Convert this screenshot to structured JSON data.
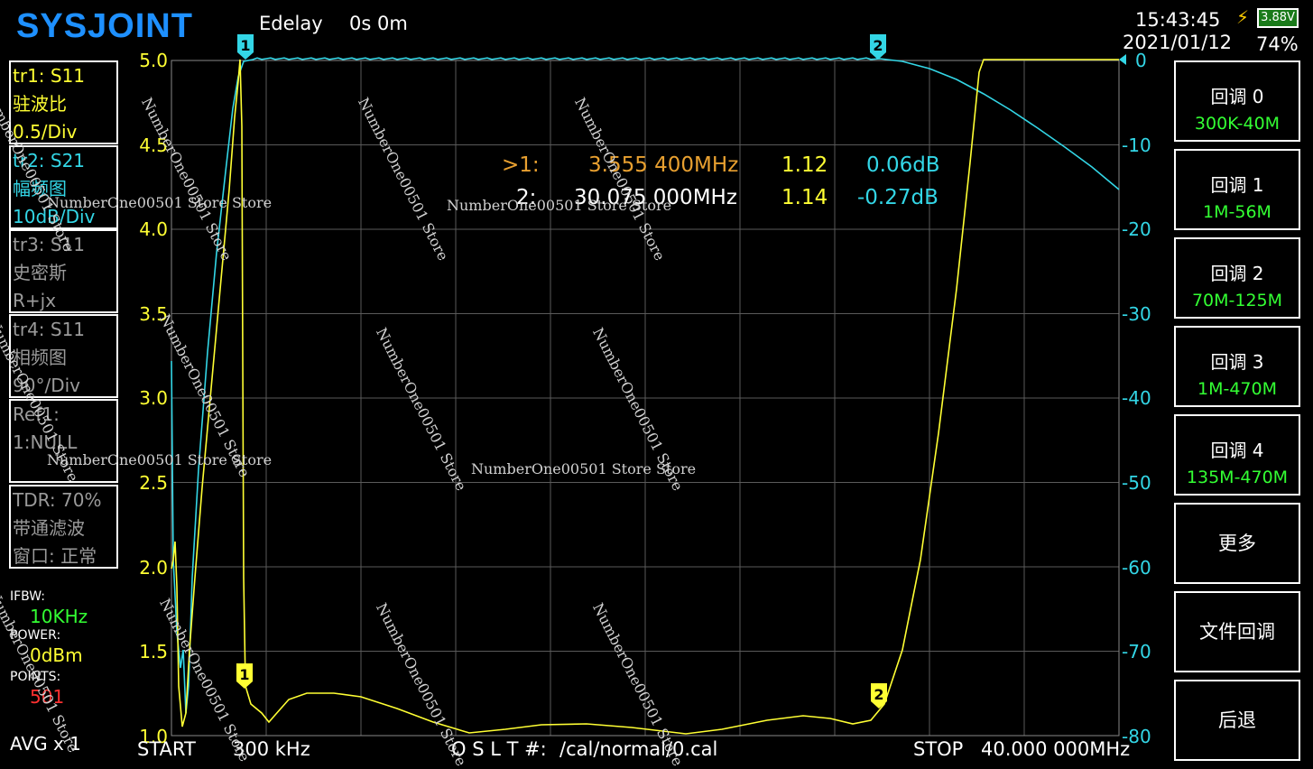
{
  "brand": "SYSJOINT",
  "header": {
    "edelay_label": "Edelay",
    "edelay_value": "0s 0m",
    "time": "15:43:45",
    "date": "2021/01/12",
    "battery_pct": "74%",
    "battery_voltage": "3.88V"
  },
  "traces": [
    {
      "line1": "tr1:   S11",
      "line2": "驻波比",
      "line3": "0.5/Div",
      "color": "#ffff33"
    },
    {
      "line1": "tr2:   S21",
      "line2": "幅频图",
      "line3": "10dB/Div",
      "color": "#33d6e6"
    },
    {
      "line1": "tr3:   S11",
      "line2": "史密斯",
      "line3": "R+jx",
      "color": "#9a9a9a"
    },
    {
      "line1": "tr4:   S11",
      "line2": "相频图",
      "line3": "90°/Div",
      "color": "#9a9a9a"
    },
    {
      "line1": "Ref1:",
      "line2": "1:NULL",
      "line3": "",
      "color": "#9a9a9a"
    },
    {
      "line1": "TDR: 70%",
      "line2": "带通滤波",
      "line3": "窗口: 正常",
      "color": "#9a9a9a"
    }
  ],
  "settings": {
    "ifbw_label": "IFBW:",
    "ifbw_value": "10KHz",
    "power_label": "POWER:",
    "power_value": "0dBm",
    "points_label": "POINTS:",
    "points_value": "501",
    "avg": "AVG x 1"
  },
  "markers": {
    "m1": {
      "prefix": ">1:",
      "freq": "3.555 400MHz",
      "swr": "1.12",
      "db": "0.06dB"
    },
    "m2": {
      "prefix": "2:",
      "freq": "30.075 000MHz",
      "swr": "1.14",
      "db": "-0.27dB"
    }
  },
  "footer": {
    "start_label": "START",
    "start_value": "300 kHz",
    "cal_label": "O S L T #:",
    "cal_path": "/cal/normal/0.cal",
    "stop_label": "STOP",
    "stop_value": "40.000 000MHz"
  },
  "left_axis": [
    "5.0",
    "4.5",
    "4.0",
    "3.5",
    "3.0",
    "2.5",
    "2.0",
    "1.5",
    "1.0"
  ],
  "right_axis": [
    "0",
    "-10",
    "-20",
    "-30",
    "-40",
    "-50",
    "-60",
    "-70",
    "-80"
  ],
  "menu": [
    {
      "title": "回调 0",
      "sub": "300K-40M"
    },
    {
      "title": "回调 1",
      "sub": "1M-56M"
    },
    {
      "title": "回调 2",
      "sub": "70M-125M"
    },
    {
      "title": "回调 3",
      "sub": "1M-470M"
    },
    {
      "title": "回调 4",
      "sub": "135M-470M"
    },
    {
      "title": "更多",
      "sub": ""
    },
    {
      "title": "文件回调",
      "sub": ""
    },
    {
      "title": "后退",
      "sub": ""
    }
  ],
  "watermark": "NumberOne00501 Store Store",
  "watermark_short": "NumberOne00501 Store",
  "marker_labels": [
    "1",
    "2"
  ],
  "colors": {
    "swr": "#ffff33",
    "s21": "#33d6e6",
    "marker1": "#e8a030",
    "ifbw": "#33ff33",
    "power": "#ffff33",
    "points": "#ff3030"
  }
}
